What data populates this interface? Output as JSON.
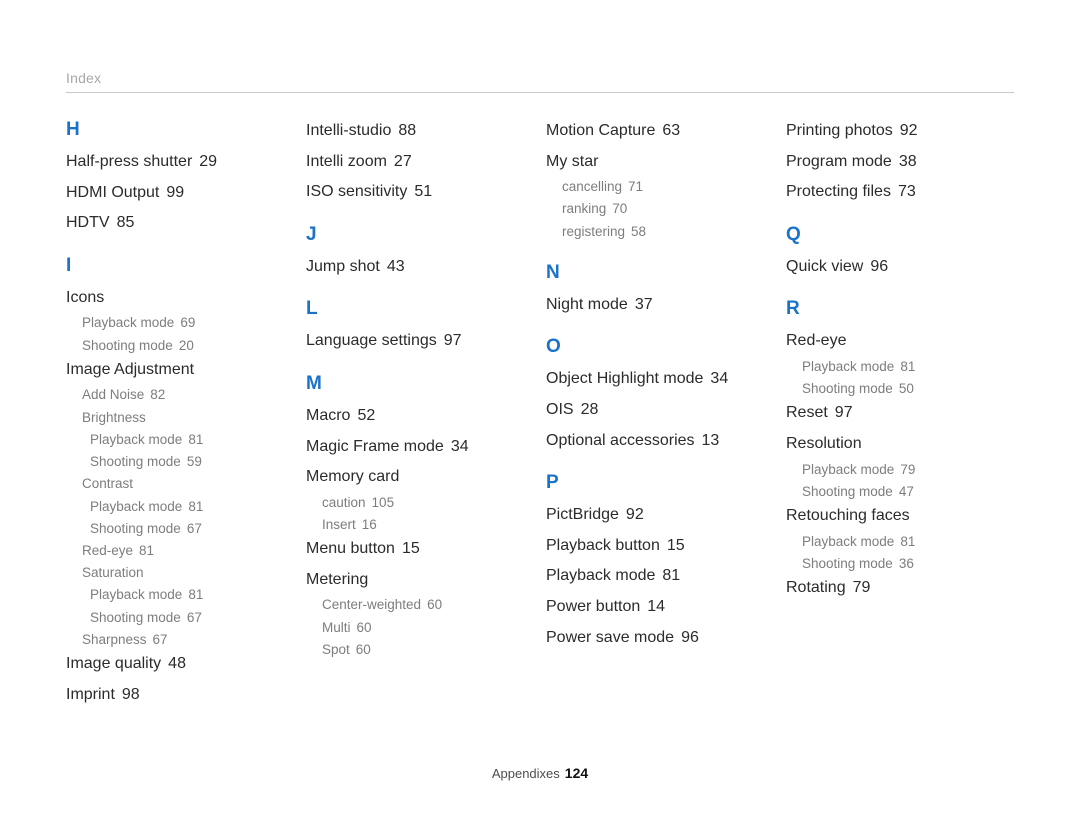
{
  "header": {
    "title": "Index"
  },
  "footer": {
    "label": "Appendixes",
    "page": "124"
  },
  "accent_color": "#1a73c8",
  "columns": [
    {
      "blocks": [
        {
          "type": "letter",
          "label": "H"
        },
        {
          "type": "entry",
          "label": "Half-press shutter",
          "page": "29"
        },
        {
          "type": "entry",
          "label": "HDMI Output",
          "page": "99"
        },
        {
          "type": "entry",
          "label": "HDTV",
          "page": "85"
        },
        {
          "type": "letter",
          "label": "I"
        },
        {
          "type": "entry",
          "label": "Icons",
          "page": ""
        },
        {
          "type": "sub",
          "label": "Playback mode",
          "page": "69"
        },
        {
          "type": "sub",
          "label": "Shooting mode",
          "page": "20"
        },
        {
          "type": "entry",
          "label": "Image Adjustment",
          "page": ""
        },
        {
          "type": "sub",
          "label": "Add Noise",
          "page": "82"
        },
        {
          "type": "sub",
          "label": "Brightness",
          "page": ""
        },
        {
          "type": "sub2",
          "label": "Playback mode",
          "page": "81"
        },
        {
          "type": "sub2",
          "label": "Shooting mode",
          "page": "59"
        },
        {
          "type": "sub",
          "label": "Contrast",
          "page": ""
        },
        {
          "type": "sub2",
          "label": "Playback mode",
          "page": "81"
        },
        {
          "type": "sub2",
          "label": "Shooting mode",
          "page": "67"
        },
        {
          "type": "sub",
          "label": "Red-eye",
          "page": "81"
        },
        {
          "type": "sub",
          "label": "Saturation",
          "page": ""
        },
        {
          "type": "sub2",
          "label": "Playback mode",
          "page": "81"
        },
        {
          "type": "sub2",
          "label": "Shooting mode",
          "page": "67"
        },
        {
          "type": "sub",
          "label": "Sharpness",
          "page": "67"
        },
        {
          "type": "entry",
          "label": "Image quality",
          "page": "48"
        },
        {
          "type": "entry",
          "label": "Imprint",
          "page": "98"
        }
      ]
    },
    {
      "blocks": [
        {
          "type": "entry",
          "label": "Intelli-studio",
          "page": "88"
        },
        {
          "type": "entry",
          "label": "Intelli zoom",
          "page": "27"
        },
        {
          "type": "entry",
          "label": "ISO sensitivity",
          "page": "51"
        },
        {
          "type": "letter",
          "label": "J"
        },
        {
          "type": "entry",
          "label": "Jump shot",
          "page": "43"
        },
        {
          "type": "letter",
          "label": "L"
        },
        {
          "type": "entry",
          "label": "Language settings",
          "page": "97"
        },
        {
          "type": "letter",
          "label": "M"
        },
        {
          "type": "entry",
          "label": "Macro",
          "page": "52"
        },
        {
          "type": "entry",
          "label": "Magic Frame mode",
          "page": "34"
        },
        {
          "type": "entry",
          "label": "Memory card",
          "page": ""
        },
        {
          "type": "sub",
          "label": "caution",
          "page": "105"
        },
        {
          "type": "sub",
          "label": "Insert",
          "page": "16"
        },
        {
          "type": "entry",
          "label": "Menu button",
          "page": "15"
        },
        {
          "type": "entry",
          "label": "Metering",
          "page": ""
        },
        {
          "type": "sub",
          "label": "Center-weighted",
          "page": "60"
        },
        {
          "type": "sub",
          "label": "Multi",
          "page": "60"
        },
        {
          "type": "sub",
          "label": "Spot",
          "page": "60"
        }
      ]
    },
    {
      "blocks": [
        {
          "type": "entry",
          "label": "Motion Capture",
          "page": "63"
        },
        {
          "type": "entry",
          "label": "My star",
          "page": ""
        },
        {
          "type": "sub",
          "label": "cancelling",
          "page": "71"
        },
        {
          "type": "sub",
          "label": "ranking",
          "page": "70"
        },
        {
          "type": "sub",
          "label": "registering",
          "page": "58"
        },
        {
          "type": "letter",
          "label": "N"
        },
        {
          "type": "entry",
          "label": "Night mode",
          "page": "37"
        },
        {
          "type": "letter",
          "label": "O"
        },
        {
          "type": "entry",
          "label": "Object Highlight mode",
          "page": "34"
        },
        {
          "type": "entry",
          "label": "OIS",
          "page": "28"
        },
        {
          "type": "entry",
          "label": "Optional accessories",
          "page": "13"
        },
        {
          "type": "letter",
          "label": "P"
        },
        {
          "type": "entry",
          "label": "PictBridge",
          "page": "92"
        },
        {
          "type": "entry",
          "label": "Playback button",
          "page": "15"
        },
        {
          "type": "entry",
          "label": "Playback mode",
          "page": "81"
        },
        {
          "type": "entry",
          "label": "Power button",
          "page": "14"
        },
        {
          "type": "entry",
          "label": "Power save mode",
          "page": "96"
        }
      ]
    },
    {
      "blocks": [
        {
          "type": "entry",
          "label": "Printing photos",
          "page": "92"
        },
        {
          "type": "entry",
          "label": "Program mode",
          "page": "38"
        },
        {
          "type": "entry",
          "label": "Protecting files",
          "page": "73"
        },
        {
          "type": "letter",
          "label": "Q"
        },
        {
          "type": "entry",
          "label": "Quick view",
          "page": "96"
        },
        {
          "type": "letter",
          "label": "R"
        },
        {
          "type": "entry",
          "label": "Red-eye",
          "page": ""
        },
        {
          "type": "sub",
          "label": "Playback mode",
          "page": "81"
        },
        {
          "type": "sub",
          "label": "Shooting mode",
          "page": "50"
        },
        {
          "type": "entry",
          "label": "Reset",
          "page": "97"
        },
        {
          "type": "entry",
          "label": "Resolution",
          "page": ""
        },
        {
          "type": "sub",
          "label": "Playback mode",
          "page": "79"
        },
        {
          "type": "sub",
          "label": "Shooting mode",
          "page": "47"
        },
        {
          "type": "entry",
          "label": "Retouching faces",
          "page": ""
        },
        {
          "type": "sub",
          "label": "Playback mode",
          "page": "81"
        },
        {
          "type": "sub",
          "label": "Shooting mode",
          "page": "36"
        },
        {
          "type": "entry",
          "label": "Rotating",
          "page": "79"
        }
      ]
    }
  ]
}
